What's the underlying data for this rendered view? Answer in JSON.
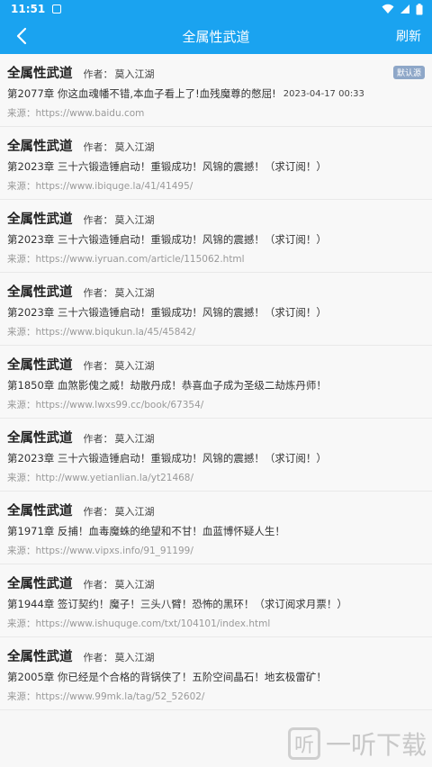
{
  "status_bar": {
    "time": "11:51"
  },
  "app_bar": {
    "title": "全属性武道",
    "refresh_label": "刷新"
  },
  "labels": {
    "author_label": "作者：",
    "source_label": "来源：",
    "default_badge": "默认源"
  },
  "items": [
    {
      "name": "全属性武道",
      "author": "莫入江湖",
      "chapter": "第2077章 你这血魂幡不错,本血子看上了!血残魔尊的憋屈!",
      "time": "2023-04-17 00:33",
      "source": "https://www.baidu.com",
      "is_default": true
    },
    {
      "name": "全属性武道",
      "author": "莫入江湖",
      "chapter": "第2023章 三十六锻造锤启动！重锻成功！风锦的震撼！（求订阅！）",
      "time": "",
      "source": "https://www.ibiquge.la/41/41495/",
      "is_default": false
    },
    {
      "name": "全属性武道",
      "author": "莫入江湖",
      "chapter": "第2023章 三十六锻造锤启动！重锻成功！风锦的震撼！（求订阅！）",
      "time": "",
      "source": "https://www.iyruan.com/article/115062.html",
      "is_default": false
    },
    {
      "name": "全属性武道",
      "author": "莫入江湖",
      "chapter": "第2023章 三十六锻造锤启动！重锻成功！风锦的震撼！（求订阅！）",
      "time": "",
      "source": "https://www.biqukun.la/45/45842/",
      "is_default": false
    },
    {
      "name": "全属性武道",
      "author": "莫入江湖",
      "chapter": "第1850章 血煞影傀之威！劫散丹成！恭喜血子成为圣级二劫炼丹师！",
      "time": "",
      "source": "https://www.lwxs99.cc/book/67354/",
      "is_default": false
    },
    {
      "name": "全属性武道",
      "author": "莫入江湖",
      "chapter": "第2023章 三十六锻造锤启动！重锻成功！风锦的震撼！（求订阅！）",
      "time": "",
      "source": "http://www.yetianlian.la/yt21468/",
      "is_default": false
    },
    {
      "name": "全属性武道",
      "author": "莫入江湖",
      "chapter": "第1971章 反捕！血毒魔蛛的绝望和不甘！血蓝博怀疑人生！",
      "time": "",
      "source": "https://www.vipxs.info/91_91199/",
      "is_default": false
    },
    {
      "name": "全属性武道",
      "author": "莫入江湖",
      "chapter": "第1944章 签订契约！魔子！三头八臂！恐怖的黑环！（求订阅求月票！）",
      "time": "",
      "source": "https://www.ishuquge.com/txt/104101/index.html",
      "is_default": false
    },
    {
      "name": "全属性武道",
      "author": "莫入江湖",
      "chapter": "第2005章 你已经是个合格的背锅侠了！五阶空间晶石！地玄极雷矿！",
      "time": "",
      "source": "https://www.99mk.la/tag/52_52602/",
      "is_default": false
    }
  ],
  "watermark": {
    "logo_char": "听",
    "text": "一听下载"
  },
  "colors": {
    "primary": "#1aa3f0",
    "badge": "#8ea7c8"
  }
}
